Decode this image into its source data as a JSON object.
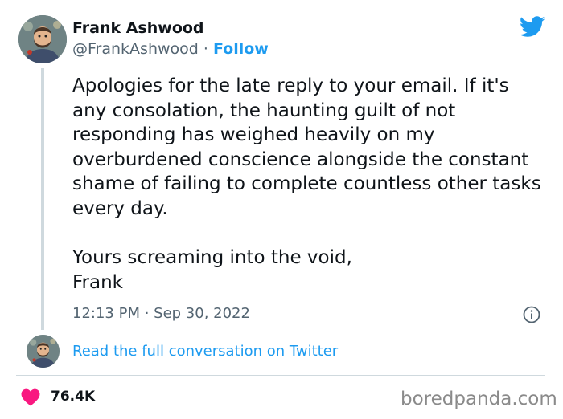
{
  "author": {
    "display_name": "Frank Ashwood",
    "handle": "@FrankAshwood",
    "separator": " · ",
    "follow_label": "Follow",
    "avatar_icon": "user-avatar"
  },
  "tweet": {
    "paragraphs": [
      "Apologies for the late reply to your email. If it's any consolation, the haunting guilt of not responding has weighed heavily on my overburdened conscience alongside the constant shame of failing to complete countless other tasks every day.",
      "Yours screaming into the void, Frank"
    ],
    "timestamp": "12:13 PM · Sep 30, 2022"
  },
  "conversation": {
    "link_label": "Read the full conversation on Twitter"
  },
  "engagement": {
    "likes": "76.4K"
  },
  "watermark": "boredpanda.com",
  "icons": {
    "brand": "twitter-bird-icon",
    "info": "info-icon",
    "like": "heart-icon"
  },
  "colors": {
    "accent": "#1d9bf0",
    "heart": "#f91880",
    "text": "#0f1419",
    "secondary": "#536471",
    "divider": "#cfd9de"
  }
}
